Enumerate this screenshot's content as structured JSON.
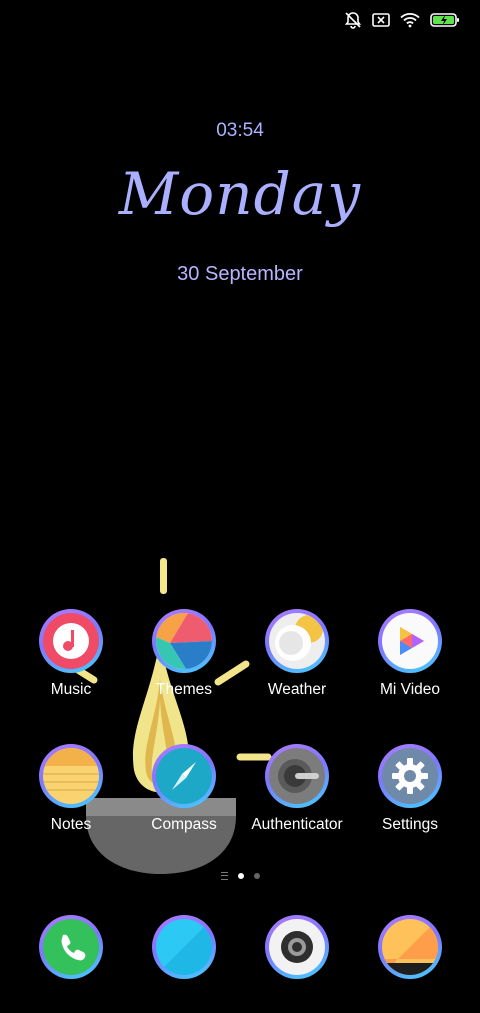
{
  "status_bar": {
    "icons": [
      "notifications-off-icon",
      "no-sim-icon",
      "wifi-icon",
      "battery-charging-icon"
    ]
  },
  "lockscreen": {
    "time": "03:54",
    "weekday": "Monday",
    "date": "30 September"
  },
  "apps": [
    {
      "label": "Music",
      "icon": "music-icon"
    },
    {
      "label": "Themes",
      "icon": "themes-icon"
    },
    {
      "label": "Weather",
      "icon": "weather-icon"
    },
    {
      "label": "Mi Video",
      "icon": "mi-video-icon"
    },
    {
      "label": "Notes",
      "icon": "notes-icon"
    },
    {
      "label": "Compass",
      "icon": "compass-icon"
    },
    {
      "label": "Authenticator",
      "icon": "authenticator-icon"
    },
    {
      "label": "Settings",
      "icon": "settings-icon"
    }
  ],
  "dock": [
    {
      "icon": "phone-icon"
    },
    {
      "icon": "messaging-icon"
    },
    {
      "icon": "camera-icon"
    },
    {
      "icon": "gallery-icon"
    }
  ],
  "page_indicator": {
    "pages": 2,
    "current": 1
  },
  "colors": {
    "accent": "#aab0ff",
    "ring_start": "#b07cff",
    "ring_end": "#41d2ff"
  }
}
